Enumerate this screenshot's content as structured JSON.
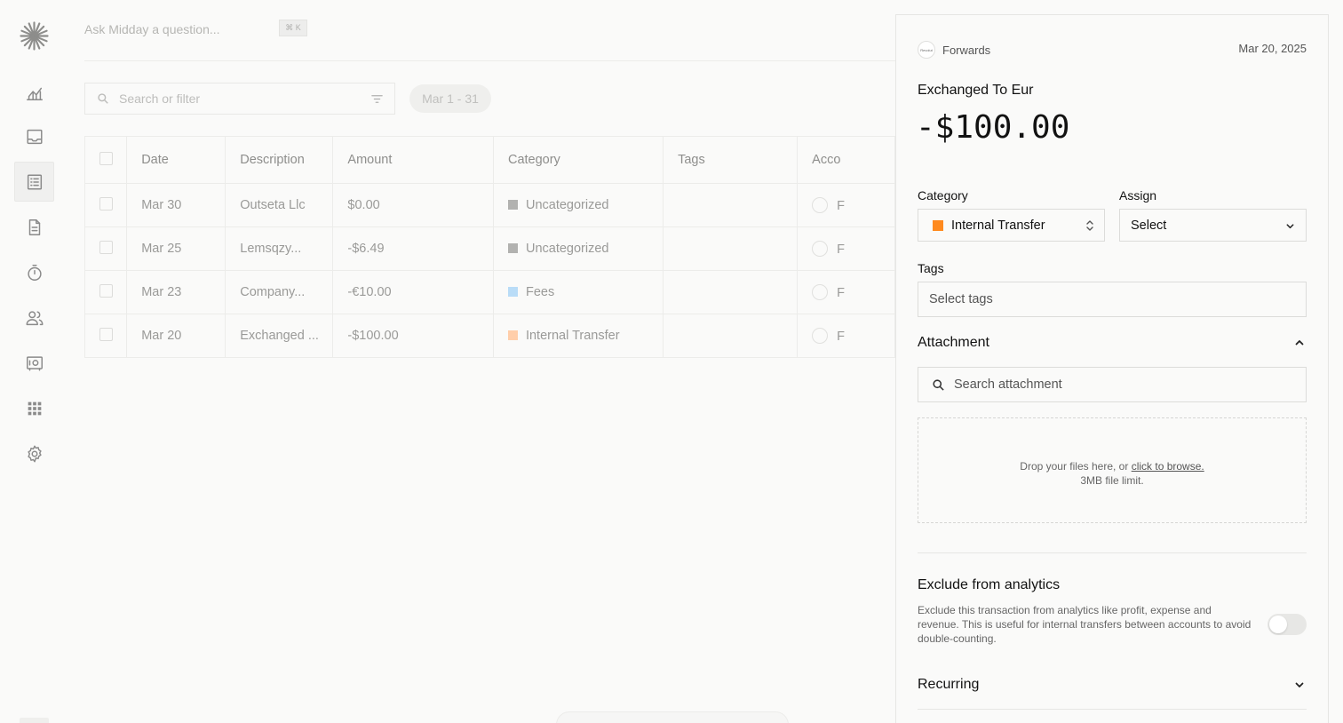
{
  "app": {
    "ask_placeholder": "Ask Midday a question...",
    "ask_shortcut": "⌘ K"
  },
  "sidebar": {
    "items": [
      {
        "icon": "chart-icon"
      },
      {
        "icon": "inbox-icon"
      },
      {
        "icon": "transactions-icon",
        "active": true
      },
      {
        "icon": "invoice-icon"
      },
      {
        "icon": "timer-icon"
      },
      {
        "icon": "customers-icon"
      },
      {
        "icon": "vault-icon"
      },
      {
        "icon": "apps-icon"
      },
      {
        "icon": "gear-icon"
      }
    ]
  },
  "toolbar": {
    "search_placeholder": "Search or filter",
    "date_range": "Mar 1 - 31"
  },
  "table": {
    "columns": [
      "Date",
      "Description",
      "Amount",
      "Category",
      "Tags",
      "Acco"
    ],
    "rows": [
      {
        "date": "Mar 30",
        "description": "Outseta Llc",
        "amount": "$0.00",
        "category": "Uncategorized",
        "category_color": "#b2b2b0",
        "tags": "",
        "account": "F"
      },
      {
        "date": "Mar 25",
        "description": "Lemsqzy...",
        "amount": "-$6.49",
        "category": "Uncategorized",
        "category_color": "#b2b2b0",
        "tags": "",
        "account": "F"
      },
      {
        "date": "Mar 23",
        "description": "Company...",
        "amount": "-€10.00",
        "category": "Fees",
        "category_color": "#b9dcf7",
        "tags": "",
        "account": "F"
      },
      {
        "date": "Mar 20",
        "description": "Exchanged ...",
        "amount": "-$100.00",
        "category": "Internal Transfer",
        "category_color": "#ffceaa",
        "tags": "",
        "account": "F"
      }
    ]
  },
  "details": {
    "bank_logo_text": "Revolut",
    "account_name": "Forwards",
    "date": "Mar 20, 2025",
    "title": "Exchanged To Eur",
    "amount": "-$100.00",
    "category_label": "Category",
    "category_value": "Internal Transfer",
    "category_color": "#ff8a1f",
    "assign_label": "Assign",
    "assign_value": "Select",
    "tags_label": "Tags",
    "tags_placeholder": "Select tags",
    "attachment_title": "Attachment",
    "attachment_search_placeholder": "Search attachment",
    "drop_text": "Drop your files here, or",
    "drop_link": "click to browse.",
    "drop_limit": "3MB file limit.",
    "exclude_title": "Exclude from analytics",
    "exclude_description": "Exclude this transaction from analytics like profit, expense and revenue. This is useful for internal transfers between accounts to avoid double-counting.",
    "exclude_enabled": false,
    "recurring_title": "Recurring"
  }
}
